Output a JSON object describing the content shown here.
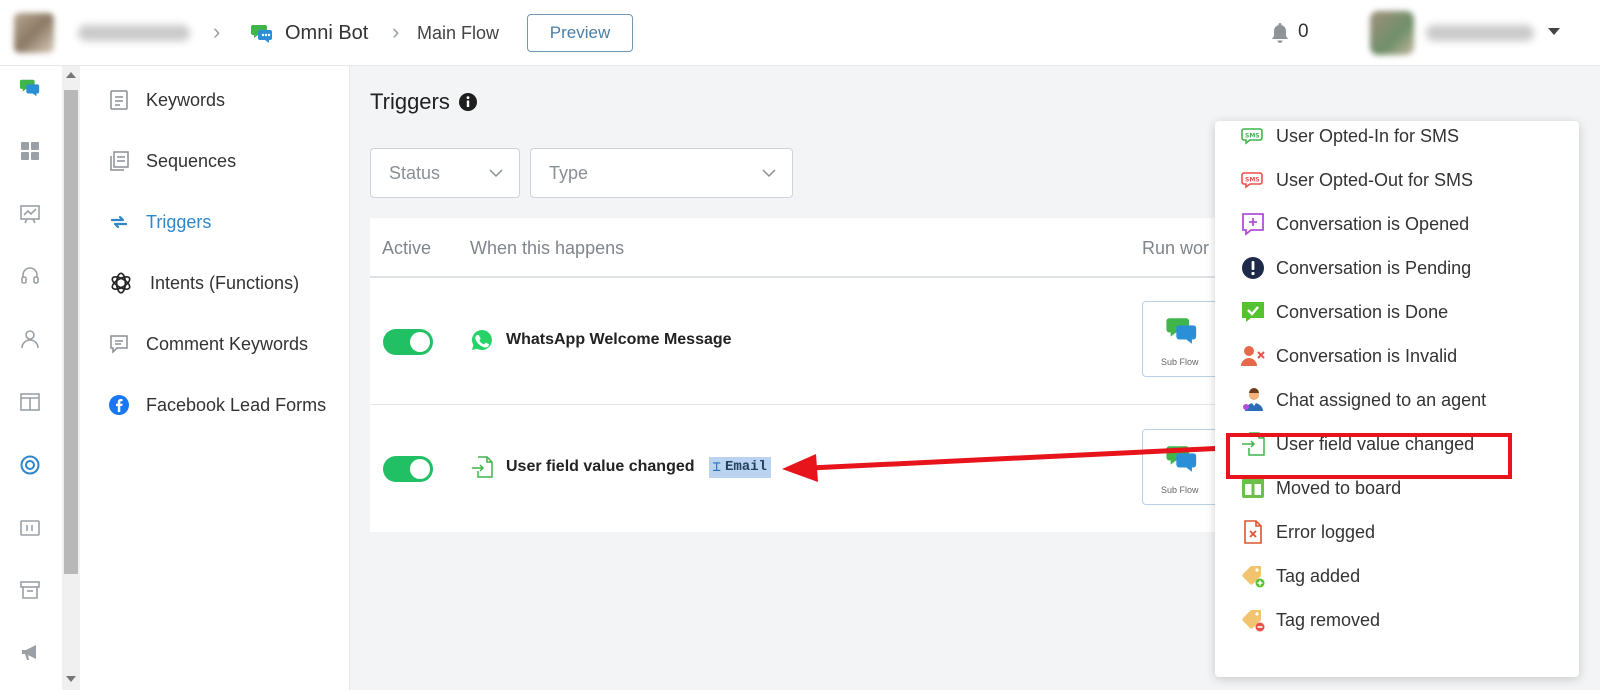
{
  "header": {
    "bot_name": "Omni Bot",
    "flow_name": "Main Flow",
    "preview_label": "Preview",
    "notification_count": "0"
  },
  "subnav": {
    "items": [
      {
        "label": "Keywords",
        "icon": "keywords-icon"
      },
      {
        "label": "Sequences",
        "icon": "sequences-icon"
      },
      {
        "label": "Triggers",
        "icon": "triggers-icon",
        "active": true
      },
      {
        "label": "Intents (Functions)",
        "icon": "openai-icon"
      },
      {
        "label": "Comment Keywords",
        "icon": "comment-icon"
      },
      {
        "label": "Facebook Lead Forms",
        "icon": "facebook-icon"
      }
    ]
  },
  "main": {
    "title": "Triggers",
    "filters": {
      "status": "Status",
      "type": "Type"
    },
    "columns": {
      "active": "Active",
      "when": "When this happens",
      "run": "Run wor"
    },
    "rows": [
      {
        "trigger": "WhatsApp Welcome Message",
        "icon": "whatsapp-icon",
        "active": true,
        "action": "Sub Flow"
      },
      {
        "trigger": "User field value changed",
        "icon": "user-field-icon",
        "active": true,
        "field": "Email",
        "action": "Sub Flow"
      }
    ]
  },
  "dropdown": {
    "items": [
      {
        "label": "User Opted-In for SMS",
        "icon": "sms-in-icon"
      },
      {
        "label": "User Opted-Out for SMS",
        "icon": "sms-out-icon"
      },
      {
        "label": "Conversation is Opened",
        "icon": "conversation-open-icon"
      },
      {
        "label": "Conversation is Pending",
        "icon": "pending-icon"
      },
      {
        "label": "Conversation is Done",
        "icon": "done-icon"
      },
      {
        "label": "Conversation is Invalid",
        "icon": "invalid-user-icon"
      },
      {
        "label": "Chat assigned to an agent",
        "icon": "agent-icon"
      },
      {
        "label": "User field value changed",
        "icon": "user-field-icon",
        "highlighted": true
      },
      {
        "label": "Moved to board",
        "icon": "board-icon"
      },
      {
        "label": "Error logged",
        "icon": "error-file-icon"
      },
      {
        "label": "Tag added",
        "icon": "tag-add-icon"
      },
      {
        "label": "Tag removed",
        "icon": "tag-remove-icon"
      }
    ]
  },
  "colors": {
    "toggle_on": "#21c064",
    "active_nav": "#2f86c8",
    "highlight": "#e8141c",
    "chip_bg": "#b9d3f1"
  }
}
